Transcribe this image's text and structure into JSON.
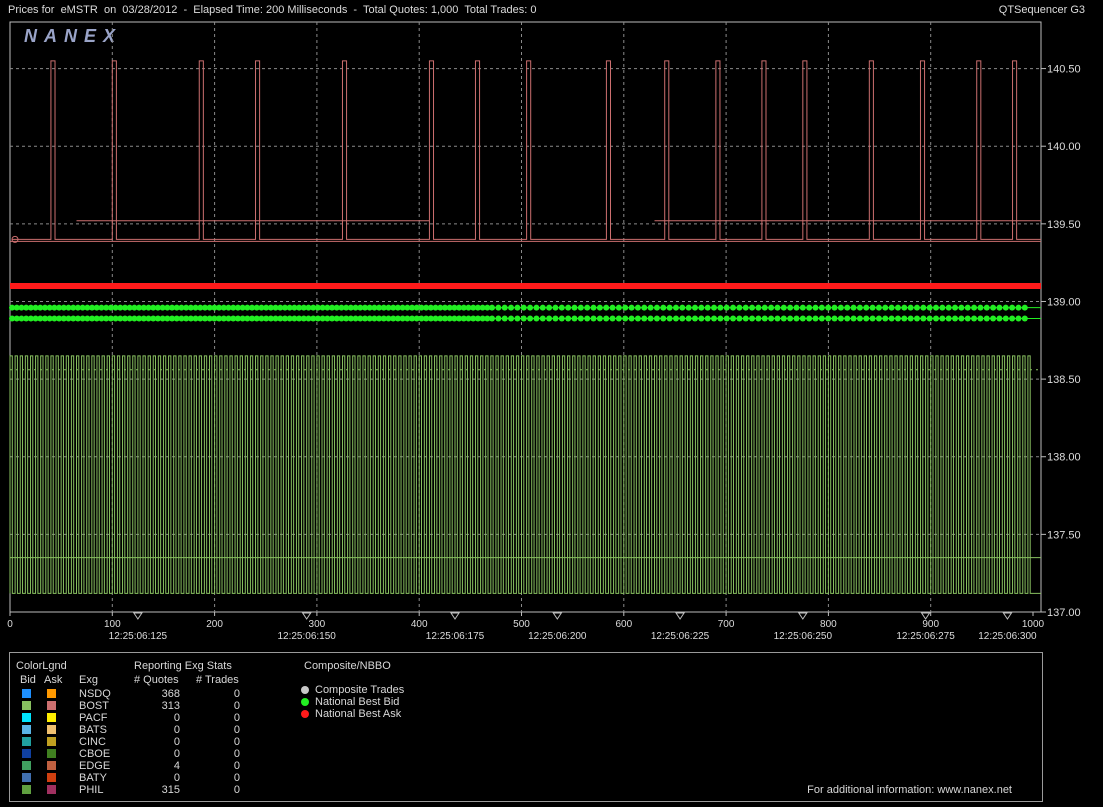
{
  "header": {
    "title_left": "Prices for  eMSTR  on  03/28/2012  -  Elapsed Time: 200 Milliseconds  -  Total Quotes: 1,000  Total Trades: 0",
    "title_right": "QTSequencer G3"
  },
  "logo": {
    "text": "NANEX"
  },
  "chart_data": {
    "type": "line",
    "x_ticks": [
      0,
      100,
      200,
      300,
      400,
      500,
      600,
      700,
      800,
      900,
      1000
    ],
    "time_labels": [
      {
        "x": 125,
        "label": "12:25:06:125"
      },
      {
        "x": 290,
        "label": "12:25:06:150"
      },
      {
        "x": 435,
        "label": "12:25:06:175"
      },
      {
        "x": 535,
        "label": "12:25:06:200"
      },
      {
        "x": 655,
        "label": "12:25:06:225"
      },
      {
        "x": 775,
        "label": "12:25:06:250"
      },
      {
        "x": 895,
        "label": "12:25:06:275"
      },
      {
        "x": 975,
        "label": "12:25:06:300"
      }
    ],
    "y_ticks": [
      "140.50",
      "140.00",
      "139.50",
      "139.00",
      "138.50",
      "138.00",
      "137.50",
      "137.00"
    ],
    "y_range": [
      137.0,
      140.8
    ],
    "x_range": [
      0,
      1000
    ],
    "grid": true,
    "series": [
      {
        "name": "National Best Ask",
        "color": "#ff1a1a",
        "level": 139.1
      },
      {
        "name": "National Best Bid",
        "color": "#22ee22",
        "levels": [
          138.96,
          138.89
        ]
      },
      {
        "name": "BOST",
        "color": "#cc6f6f",
        "low": 139.4,
        "high": 140.55,
        "mid": 139.52,
        "count": 26
      },
      {
        "name": "NSDQ",
        "color": "#88c060",
        "low": 137.12,
        "high": 138.65,
        "mid": 137.35,
        "count": 200
      }
    ]
  },
  "legend": {
    "color_legend": "ColorLgnd",
    "bid_header": "Bid",
    "ask_header": "Ask",
    "exg_header": "Exg",
    "stats_title": "Reporting Exg Stats",
    "quotes_header": "# Quotes",
    "trades_header": "# Trades",
    "composite_title": "Composite/NBBO",
    "rows": [
      {
        "exg": "NSDQ",
        "quotes": "368",
        "trades": "0",
        "bid_color": "#1e90ff",
        "ask_color": "#ff9900"
      },
      {
        "exg": "BOST",
        "quotes": "313",
        "trades": "0",
        "bid_color": "#88c060",
        "ask_color": "#cc6f6f"
      },
      {
        "exg": "PACF",
        "quotes": "0",
        "trades": "0",
        "bid_color": "#00e5ff",
        "ask_color": "#ffee00"
      },
      {
        "exg": "BATS",
        "quotes": "0",
        "trades": "0",
        "bid_color": "#5ab4e6",
        "ask_color": "#f0c070"
      },
      {
        "exg": "CINC",
        "quotes": "0",
        "trades": "0",
        "bid_color": "#20a0a0",
        "ask_color": "#c0a020"
      },
      {
        "exg": "CBOE",
        "quotes": "0",
        "trades": "0",
        "bid_color": "#1040a0",
        "ask_color": "#408020"
      },
      {
        "exg": "EDGE",
        "quotes": "4",
        "trades": "0",
        "bid_color": "#40a060",
        "ask_color": "#c06040"
      },
      {
        "exg": "BATY",
        "quotes": "0",
        "trades": "0",
        "bid_color": "#4070b0",
        "ask_color": "#d04010"
      },
      {
        "exg": "PHIL",
        "quotes": "315",
        "trades": "0",
        "bid_color": "#60a040",
        "ask_color": "#a03060"
      }
    ],
    "composite": [
      {
        "label": "Composite Trades",
        "color": "#c8c8c8"
      },
      {
        "label": "National Best Bid",
        "color": "#22ee22"
      },
      {
        "label": "National Best Ask",
        "color": "#ff1a1a"
      }
    ],
    "footer": "For additional information: www.nanex.net"
  }
}
